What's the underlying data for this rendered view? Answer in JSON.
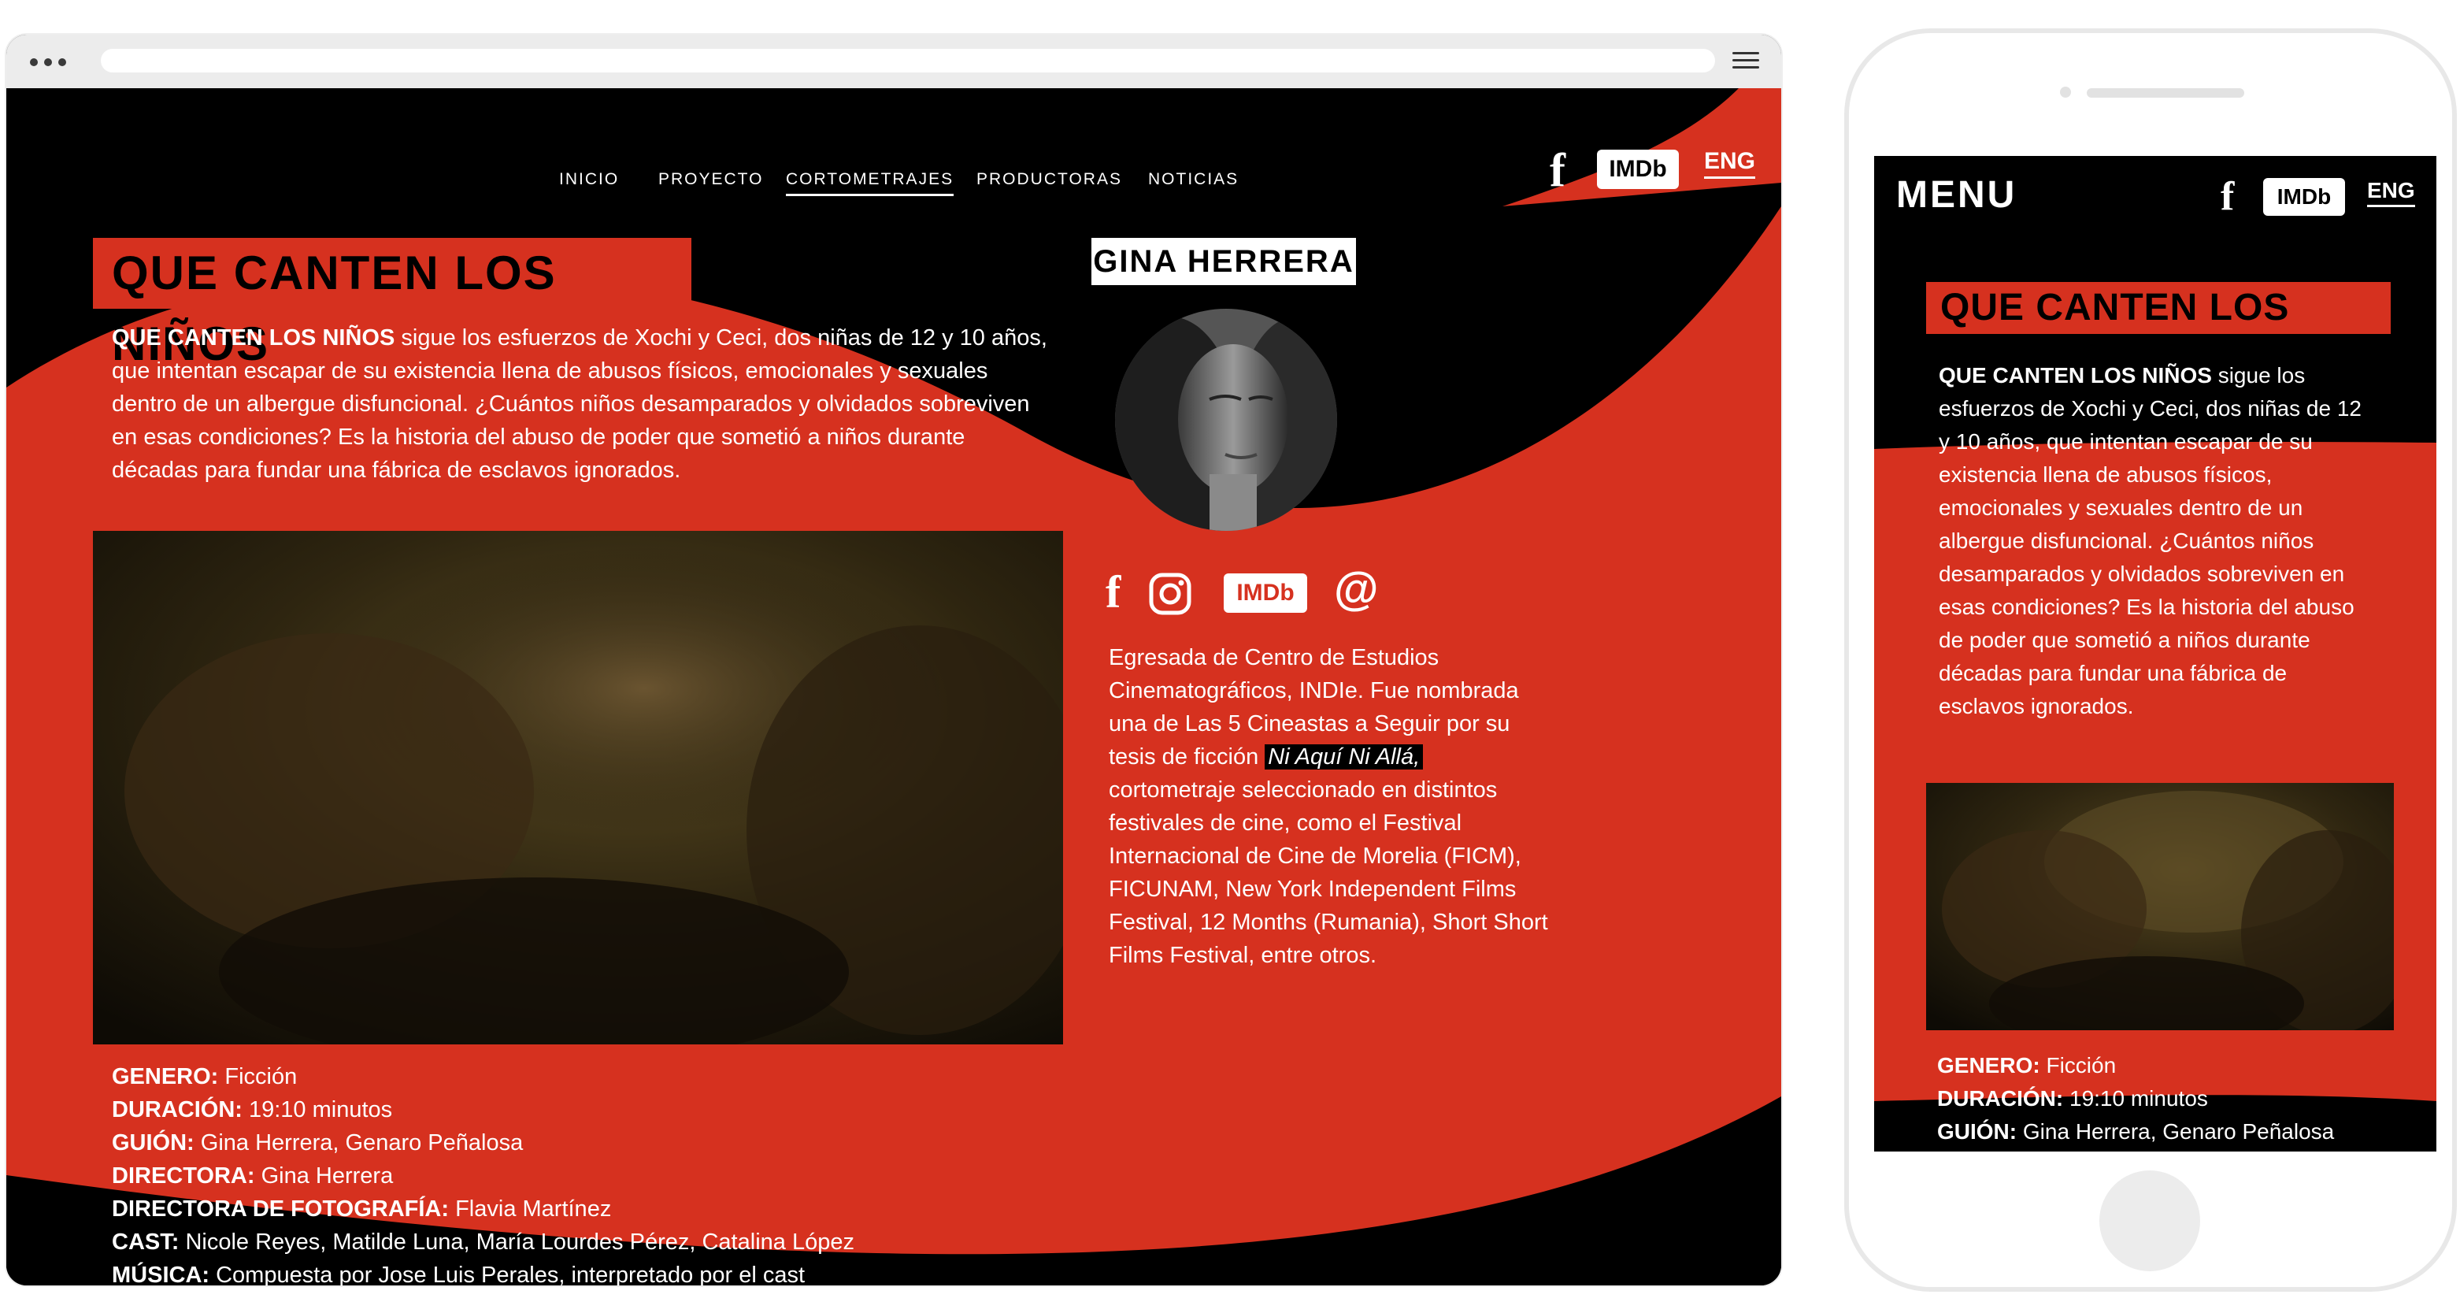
{
  "colors": {
    "brand_red": "#d6311f",
    "black": "#000000",
    "white": "#ffffff"
  },
  "browser": {
    "nav": [
      {
        "label": "INICIO",
        "active": false
      },
      {
        "label": "PROYECTO",
        "active": false
      },
      {
        "label": "CORTOMETRAJES",
        "active": true
      },
      {
        "label": "PRODUCTORAS",
        "active": false
      },
      {
        "label": "NOTICIAS",
        "active": false
      }
    ],
    "social": {
      "facebook": "f",
      "imdb": "IMDb",
      "lang": "ENG"
    },
    "film": {
      "title": "QUE CANTEN LOS NIÑOS",
      "synopsis_lead": "QUE CANTEN LOS NIÑOS",
      "synopsis_rest": " sigue los esfuerzos de Xochi y Ceci, dos niñas de 12 y 10 años, que intentan escapar de su existencia llena de abusos físicos, emocionales y sexuales dentro de un albergue disfuncional. ¿Cuántos niños desamparados y olvidados sobreviven en esas condiciones? Es la historia del abuso de poder que sometió a niños durante décadas para fundar una fábrica de esclavos ignorados.",
      "credits": [
        {
          "label": "GENERO:",
          "value": " Ficción"
        },
        {
          "label": "DURACIÓN:",
          "value": " 19:10 minutos"
        },
        {
          "label": "GUIÓN:",
          "value": " Gina Herrera, Genaro Peñalosa"
        },
        {
          "label": "DIRECTORA:",
          "value": " Gina Herrera"
        },
        {
          "label": "DIRECTORA DE FOTOGRAFÍA:",
          "value": " Flavia Martínez"
        },
        {
          "label": "CAST:",
          "value": " Nicole Reyes, Matilde Luna, María Lourdes Pérez, Catalina López"
        },
        {
          "label": "MÚSICA:",
          "value": " Compuesta por Jose Luis Perales, interpretado por el cast"
        }
      ]
    },
    "director": {
      "name": "GINA HERRERA",
      "social": {
        "facebook": "f",
        "instagram": "instagram-icon",
        "imdb": "IMDb",
        "email": "@"
      },
      "bio_before": "Egresada de Centro de Estudios Cinematográficos, INDIe. Fue nombrada una de Las 5 Cineastas a Seguir por su tesis de ficción ",
      "bio_highlight": "Ni Aquí Ni Allá,",
      "bio_after": " cortometraje seleccionado en distintos festivales de cine, como el Festival Internacional de Cine de Morelia (FICM), FICUNAM, New York Independent Films Festival, 12 Months (Rumania), Short Short Films Festival, entre otros."
    }
  },
  "phone": {
    "menu": "MENU",
    "social": {
      "facebook": "f",
      "imdb": "IMDb",
      "lang": "ENG"
    },
    "title": "QUE CANTEN LOS NIÑOS",
    "synopsis_lead": "QUE CANTEN LOS NIÑOS",
    "synopsis_rest": " sigue los esfuerzos de Xochi y Ceci, dos niñas de 12 y 10 años, que intentan escapar de su existencia llena de abusos físicos, emocionales y sexuales dentro de un albergue disfuncional. ¿Cuántos niños desamparados y olvidados sobreviven en esas condiciones? Es la historia del abuso de poder que sometió a niños durante décadas para fundar una fábrica de esclavos ignorados.",
    "credits": [
      {
        "label": "GENERO:",
        "value": " Ficción"
      },
      {
        "label": "DURACIÓN:",
        "value": " 19:10 minutos"
      },
      {
        "label": "GUIÓN:",
        "value": " Gina Herrera, Genaro Peñalosa"
      }
    ]
  }
}
